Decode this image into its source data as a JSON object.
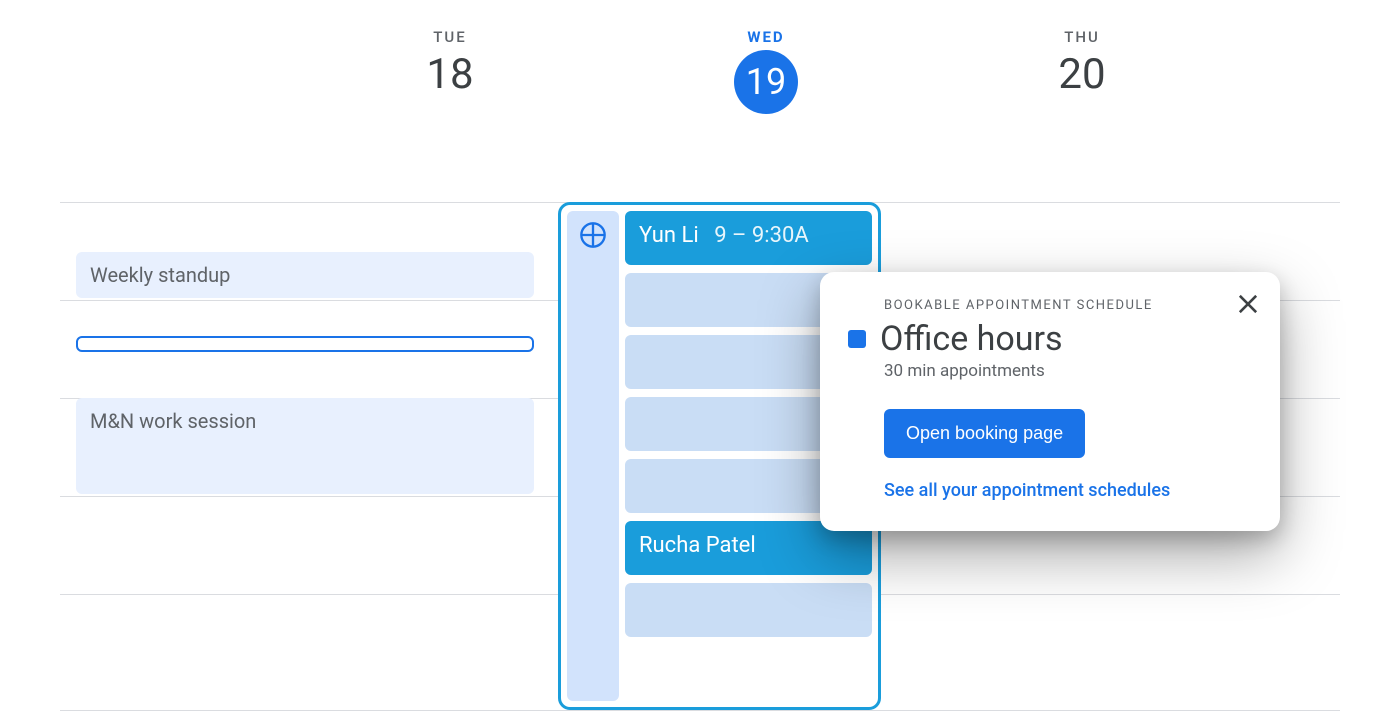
{
  "days": [
    {
      "dow": "TUE",
      "dom": "18",
      "today": false
    },
    {
      "dow": "WED",
      "dom": "19",
      "today": true
    },
    {
      "dow": "THU",
      "dom": "20",
      "today": false
    }
  ],
  "tue_events": [
    {
      "title": "Weekly standup"
    },
    {
      "title": "M&N work session"
    }
  ],
  "wed_slots": [
    {
      "booked": true,
      "name": "Yun Li",
      "time": "9 – 9:30A"
    },
    {
      "booked": false
    },
    {
      "booked": false
    },
    {
      "booked": false
    },
    {
      "booked": false
    },
    {
      "booked": true,
      "name": "Rucha Patel",
      "time": ""
    },
    {
      "booked": false
    }
  ],
  "popover": {
    "label": "BOOKABLE APPOINTMENT SCHEDULE",
    "title": "Office hours",
    "subtitle": "30 min appointments",
    "button": "Open booking page",
    "link": "See all your appointment schedules"
  }
}
